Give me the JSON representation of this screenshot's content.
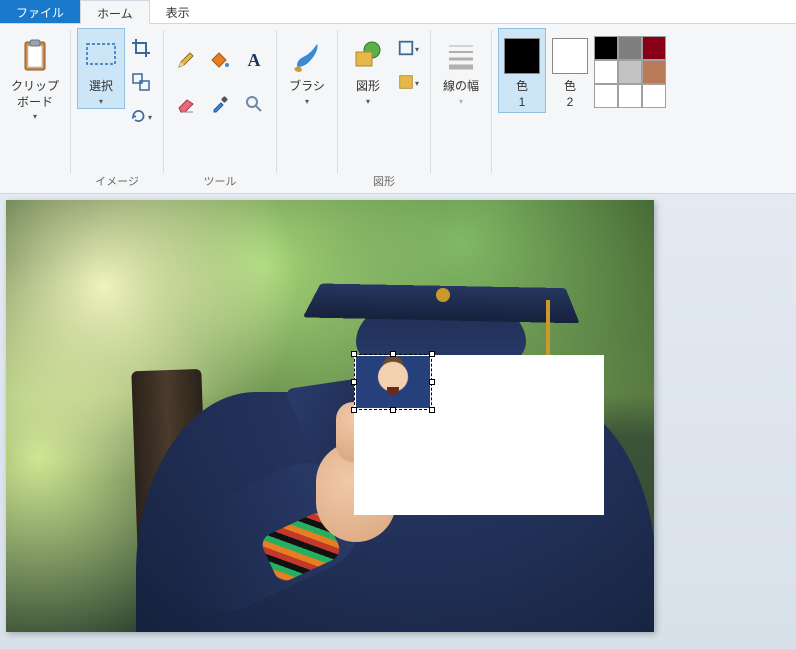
{
  "tabs": {
    "file": "ファイル",
    "home": "ホーム",
    "view": "表示"
  },
  "ribbon": {
    "clipboard": {
      "label": "クリップ\nボード"
    },
    "image": {
      "select": "選択",
      "group_label": "イメージ"
    },
    "tools": {
      "group_label": "ツール"
    },
    "brushes": {
      "label": "ブラシ"
    },
    "shapes": {
      "label": "図形",
      "group_label": "図形"
    },
    "stroke": {
      "label": "線の幅"
    },
    "colors": {
      "c1_label": "色\n1",
      "c2_label": "色\n2",
      "c1_value": "#000000",
      "c2_value": "#ffffff",
      "palette": [
        "#000000",
        "#7f7f7f",
        "#880015",
        "#ffffff",
        "#c3c3c3",
        "#b97a57",
        "#ffffff",
        "#ffffff",
        "#ffffff"
      ]
    }
  }
}
